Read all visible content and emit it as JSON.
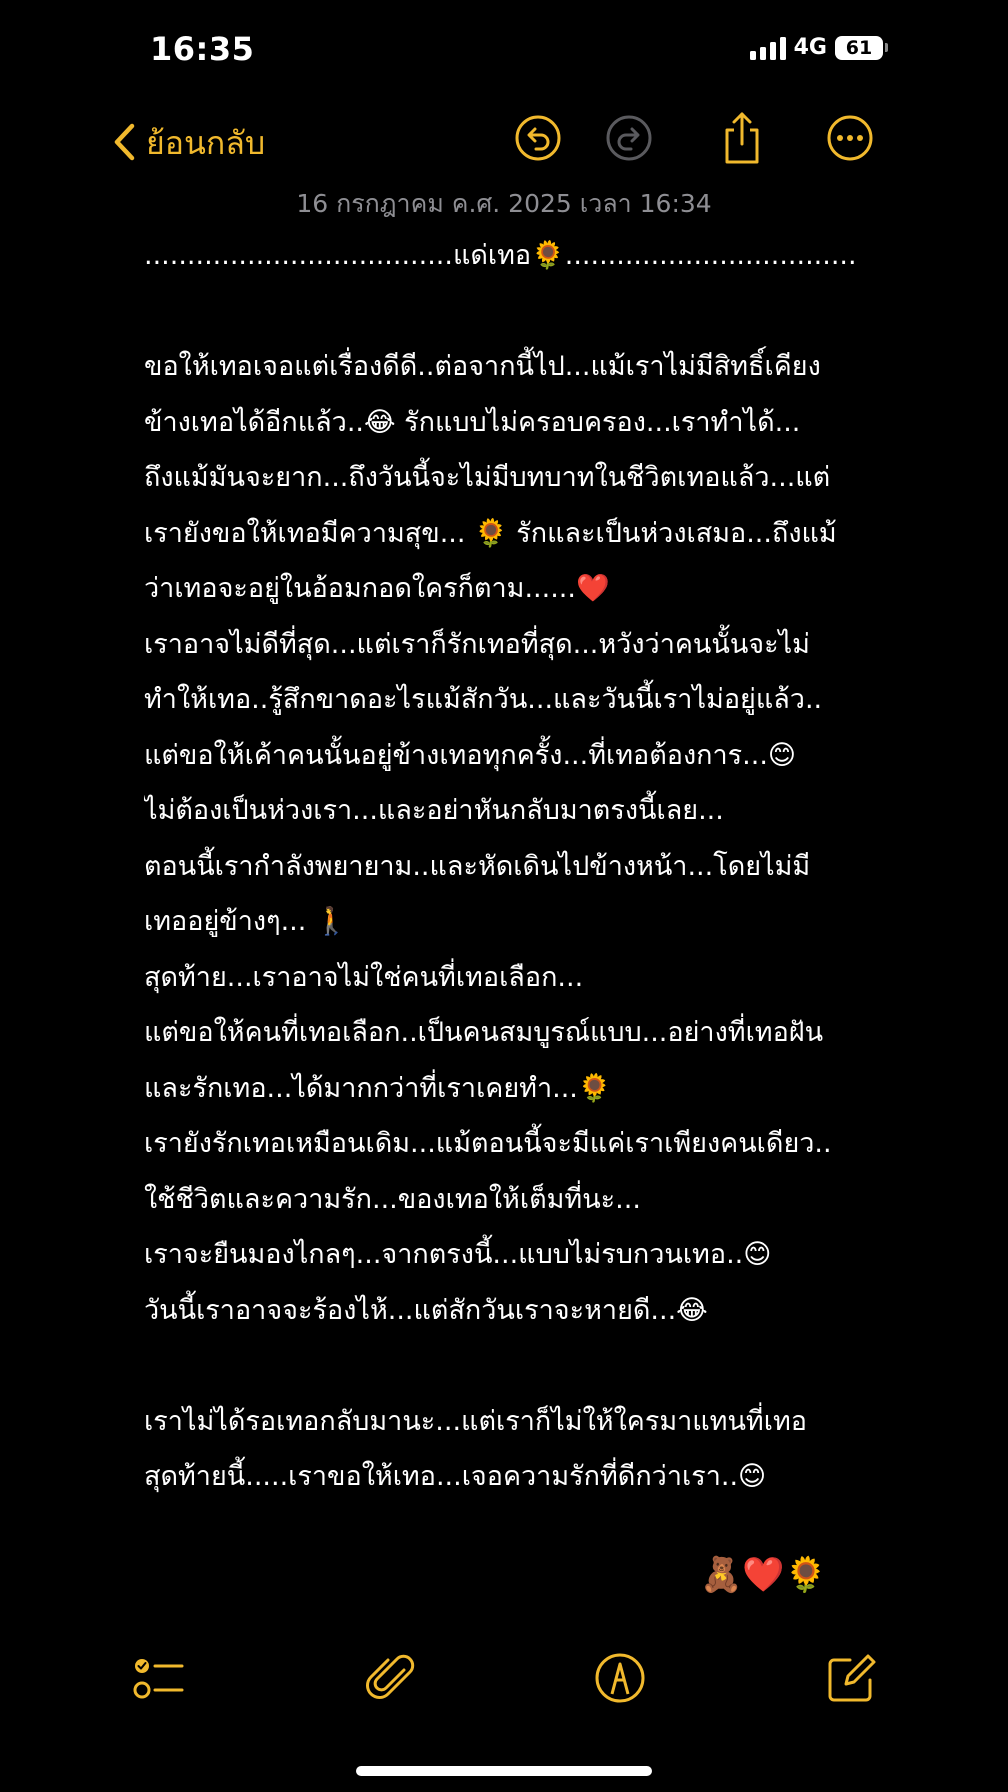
{
  "status_bar": {
    "time": "16:35",
    "network": "4G",
    "battery": "61"
  },
  "toolbar": {
    "back_label": "ย้อนกลับ",
    "icons": [
      "chevron-left-icon",
      "undo-icon",
      "redo-icon",
      "share-icon",
      "more-icon"
    ]
  },
  "note": {
    "date": "16 กรกฎาคม ค.ศ. 2025 เวลา 16:34",
    "lines": [
      "....................................แด่เทอ🌻..................................",
      "",
      "ขอให้เทอเจอแต่เรื่องดีดี..ต่อจากนี้ไป...แม้เราไม่มีสิทธิ์เคียง",
      "ข้างเทอได้อีกแล้ว..😂 รักแบบไม่ครอบครอง...เราทำได้...",
      "ถึงแม้มันจะยาก...ถึงวันนี้จะไม่มีบทบาทในชีวิตเทอแล้ว...แต่",
      "เรายังขอให้เทอมีความสุข... 🌻 รักและเป็นห่วงเสมอ...ถึงแม้",
      "ว่าเทอจะอยู่ในอ้อมกอดใครก็ตาม......❤️",
      "เราอาจไม่ดีที่สุด...แต่เราก็รักเทอที่สุด...หวังว่าคนนั้นจะไม่",
      "ทำให้เทอ..รู้สึกขาดอะไรแม้สักวัน...และวันนี้เราไม่อยู่แล้ว..",
      "แต่ขอให้เค้าคนนั้นอยู่ข้างเทอทุกครั้ง...ที่เทอต้องการ...😊",
      "ไม่ต้องเป็นห่วงเรา...และอย่าหันกลับมาตรงนี้เลย...",
      "ตอนนี้เรากำลังพยายาม..และหัดเดินไปข้างหน้า...โดยไม่มี",
      "เทออยู่ข้างๆ... 🚶",
      "สุดท้าย...เราอาจไม่ใช่คนที่เทอเลือก...",
      "แต่ขอให้คนที่เทอเลือก..เป็นคนสมบูรณ์แบบ...อย่างที่เทอฝัน",
      "และรักเทอ...ได้มากกว่าที่เราเคยทำ...🌻",
      "เรายังรักเทอเหมือนเดิม...แม้ตอนนี้จะมีแค่เราเพียงคนเดียว..",
      "ใช้ชีวิตและความรัก...ของเทอให้เต็มที่นะ...",
      "เราจะยืนมองไกลๆ...จากตรงนี้...แบบไม่รบกวนเทอ..😊",
      "วันนี้เราอาจจะร้องไห้...แต่สักวันเราจะหายดี...😂",
      "",
      "เราไม่ได้รอเทอกลับมานะ...แต่เราก็ไม่ให้ใครมาแทนที่เทอ",
      "สุดท้ายนี้.....เราขอให้เทอ...เจอความรักที่ดีกว่าเรา..😊"
    ],
    "signoff": "🧸❤️🌻"
  },
  "bottom_toolbar": {
    "icons": [
      "checklist-icon",
      "paperclip-icon",
      "markup-pen-icon",
      "compose-icon"
    ]
  },
  "colors": {
    "accent": "#f1b92d",
    "disabled": "#5a5a5e",
    "date_text": "#8e8e93",
    "background": "#000000"
  }
}
